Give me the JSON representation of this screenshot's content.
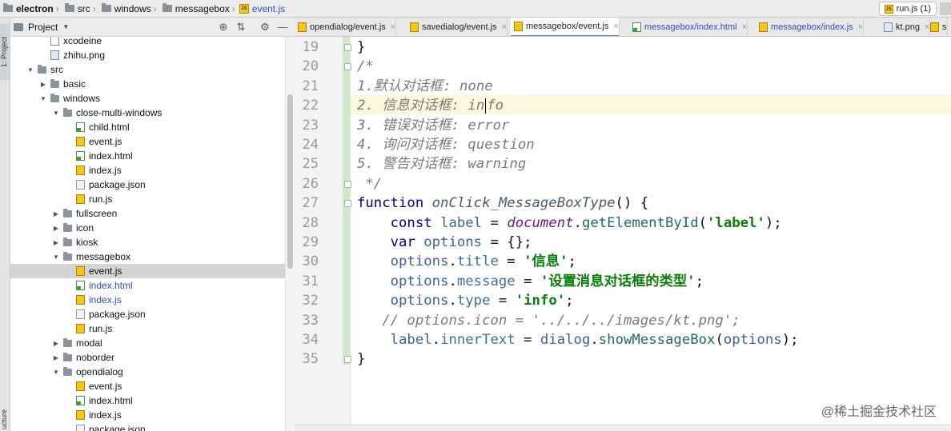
{
  "breadcrumb": [
    {
      "label": "electron",
      "type": "folder"
    },
    {
      "label": "src",
      "type": "folder"
    },
    {
      "label": "windows",
      "type": "folder"
    },
    {
      "label": "messagebox",
      "type": "folder"
    },
    {
      "label": "event.js",
      "type": "js"
    }
  ],
  "run_config": {
    "label": "run.js (1)"
  },
  "left_strip": {
    "project_label": "1: Project",
    "structure_label": "ucture"
  },
  "project_panel": {
    "title": "Project",
    "tools": [
      "⊕",
      "⇅",
      "⚙",
      "—"
    ],
    "tree": [
      {
        "label": "xcodeine",
        "type": "file",
        "depth": 2
      },
      {
        "label": "zhihu.png",
        "type": "png",
        "depth": 2
      },
      {
        "label": "src",
        "type": "folder",
        "open": true,
        "depth": 1
      },
      {
        "label": "basic",
        "type": "folder",
        "open": false,
        "depth": 2
      },
      {
        "label": "windows",
        "type": "folder",
        "open": true,
        "depth": 2
      },
      {
        "label": "close-multi-windows",
        "type": "folder",
        "open": true,
        "depth": 3
      },
      {
        "label": "child.html",
        "type": "html",
        "depth": 4
      },
      {
        "label": "event.js",
        "type": "js",
        "depth": 4
      },
      {
        "label": "index.html",
        "type": "html",
        "depth": 4
      },
      {
        "label": "index.js",
        "type": "js",
        "depth": 4
      },
      {
        "label": "package.json",
        "type": "json",
        "depth": 4
      },
      {
        "label": "run.js",
        "type": "js",
        "depth": 4
      },
      {
        "label": "fullscreen",
        "type": "folder",
        "open": false,
        "depth": 3
      },
      {
        "label": "icon",
        "type": "folder",
        "open": false,
        "depth": 3
      },
      {
        "label": "kiosk",
        "type": "folder",
        "open": false,
        "depth": 3
      },
      {
        "label": "messagebox",
        "type": "folder",
        "open": true,
        "depth": 3
      },
      {
        "label": "event.js",
        "type": "js",
        "depth": 4,
        "selected": true
      },
      {
        "label": "index.html",
        "type": "html",
        "depth": 4,
        "blue": true
      },
      {
        "label": "index.js",
        "type": "js",
        "depth": 4,
        "blue": true
      },
      {
        "label": "package.json",
        "type": "json",
        "depth": 4
      },
      {
        "label": "run.js",
        "type": "js",
        "depth": 4
      },
      {
        "label": "modal",
        "type": "folder",
        "open": false,
        "depth": 3
      },
      {
        "label": "noborder",
        "type": "folder",
        "open": false,
        "depth": 3
      },
      {
        "label": "opendialog",
        "type": "folder",
        "open": true,
        "depth": 3
      },
      {
        "label": "event.js",
        "type": "js",
        "depth": 4
      },
      {
        "label": "index.html",
        "type": "html",
        "depth": 4
      },
      {
        "label": "index.js",
        "type": "js",
        "depth": 4
      },
      {
        "label": "package.json",
        "type": "json",
        "depth": 4
      }
    ]
  },
  "tabs": [
    {
      "label": "opendialog/event.js",
      "type": "js",
      "active": false
    },
    {
      "label": "savedialog/event.js",
      "type": "js",
      "active": false
    },
    {
      "label": "messagebox/event.js",
      "type": "js",
      "active": true
    },
    {
      "label": "messagebox/index.html",
      "type": "html",
      "active": false,
      "blue": true
    },
    {
      "label": "messagebox/index.js",
      "type": "js",
      "active": false,
      "blue": true
    },
    {
      "label": "kt.png",
      "type": "png",
      "active": false
    },
    {
      "label": "s",
      "type": "js",
      "active": false
    }
  ],
  "editor": {
    "current_line": 22,
    "lines": [
      {
        "n": 19,
        "tokens": [
          [
            "t",
            "}"
          ]
        ]
      },
      {
        "n": 20,
        "tokens": [
          [
            "cm",
            "/*"
          ]
        ]
      },
      {
        "n": 21,
        "tokens": [
          [
            "cm",
            "1.默认对话框: none"
          ]
        ]
      },
      {
        "n": 22,
        "tokens": [
          [
            "cm",
            "2. 信息对话框: in"
          ],
          [
            "caret",
            ""
          ],
          [
            "cm",
            "fo"
          ]
        ]
      },
      {
        "n": 23,
        "tokens": [
          [
            "cm",
            "3. 错误对话框: error"
          ]
        ]
      },
      {
        "n": 24,
        "tokens": [
          [
            "cm",
            "4. 询问对话框: question"
          ]
        ]
      },
      {
        "n": 25,
        "tokens": [
          [
            "cm",
            "5. 警告对话框: warning"
          ]
        ]
      },
      {
        "n": 26,
        "tokens": [
          [
            "cm",
            " */"
          ]
        ]
      },
      {
        "n": 27,
        "tokens": [
          [
            "kw",
            "function "
          ],
          [
            "fnname",
            "onClick_MessageBoxType"
          ],
          [
            "t",
            "() {"
          ]
        ]
      },
      {
        "n": 28,
        "tokens": [
          [
            "t",
            "    "
          ],
          [
            "kw",
            "const "
          ],
          [
            "var",
            "label"
          ],
          [
            "t",
            " = "
          ],
          [
            "glob",
            "document"
          ],
          [
            "t",
            "."
          ],
          [
            "meth",
            "getElementById"
          ],
          [
            "t",
            "("
          ],
          [
            "str",
            "'label'"
          ],
          [
            "t",
            ");"
          ]
        ]
      },
      {
        "n": 29,
        "tokens": [
          [
            "t",
            "    "
          ],
          [
            "kw",
            "var "
          ],
          [
            "var",
            "options"
          ],
          [
            "t",
            " = {};"
          ]
        ]
      },
      {
        "n": 30,
        "tokens": [
          [
            "t",
            "    "
          ],
          [
            "var",
            "options"
          ],
          [
            "t",
            "."
          ],
          [
            "prop",
            "title"
          ],
          [
            "t",
            " = "
          ],
          [
            "str",
            "'信息'"
          ],
          [
            "t",
            ";"
          ]
        ]
      },
      {
        "n": 31,
        "tokens": [
          [
            "t",
            "    "
          ],
          [
            "var",
            "options"
          ],
          [
            "t",
            "."
          ],
          [
            "prop",
            "message"
          ],
          [
            "t",
            " = "
          ],
          [
            "str",
            "'设置消息对话框的类型'"
          ],
          [
            "t",
            ";"
          ]
        ]
      },
      {
        "n": 32,
        "tokens": [
          [
            "t",
            "    "
          ],
          [
            "var",
            "options"
          ],
          [
            "t",
            "."
          ],
          [
            "prop",
            "type"
          ],
          [
            "t",
            " = "
          ],
          [
            "str",
            "'info'"
          ],
          [
            "t",
            ";"
          ]
        ]
      },
      {
        "n": 33,
        "tokens": [
          [
            "t",
            "   "
          ],
          [
            "cm",
            "// options.icon = '../../../images/kt.png';"
          ]
        ]
      },
      {
        "n": 34,
        "tokens": [
          [
            "t",
            "    "
          ],
          [
            "var",
            "label"
          ],
          [
            "t",
            "."
          ],
          [
            "prop",
            "innerText"
          ],
          [
            "t",
            " = "
          ],
          [
            "var",
            "dialog"
          ],
          [
            "t",
            "."
          ],
          [
            "meth",
            "showMessageBox"
          ],
          [
            "t",
            "("
          ],
          [
            "var",
            "options"
          ],
          [
            "t",
            ");"
          ]
        ]
      },
      {
        "n": 35,
        "tokens": [
          [
            "t",
            "}"
          ]
        ]
      }
    ]
  },
  "watermark": "@稀土掘金技术社区"
}
